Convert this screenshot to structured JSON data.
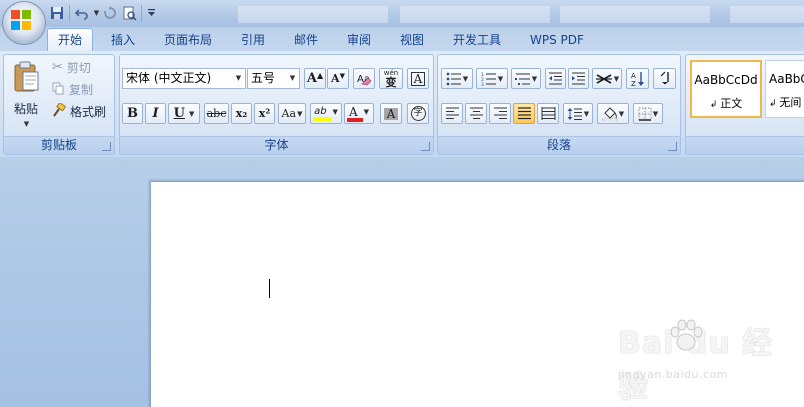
{
  "quick_access": {
    "icons": [
      "save-icon",
      "undo-icon",
      "redo-icon",
      "print-preview-icon",
      "customize-dropdown-icon"
    ]
  },
  "tabs": [
    {
      "label": "开始",
      "active": true
    },
    {
      "label": "插入"
    },
    {
      "label": "页面布局"
    },
    {
      "label": "引用"
    },
    {
      "label": "邮件"
    },
    {
      "label": "审阅"
    },
    {
      "label": "视图"
    },
    {
      "label": "开发工具"
    },
    {
      "label": "WPS PDF"
    }
  ],
  "clipboard": {
    "paste_label": "粘贴",
    "cut_label": "剪切",
    "copy_label": "复制",
    "format_painter_label": "格式刷",
    "group_label": "剪贴板"
  },
  "font": {
    "font_name": "宋体 (中文正文)",
    "font_size": "五号",
    "grow_label": "A",
    "shrink_label": "A",
    "clear_label": "A",
    "phonetic_label": "wén",
    "phonetic_char": "变",
    "border_label": "A",
    "bold": "B",
    "italic": "I",
    "underline": "U",
    "strike": "abc",
    "subscript": "x₂",
    "superscript": "x²",
    "case": "Aa",
    "highlight": "ab",
    "font_color": "A",
    "shading": "A",
    "enclose": "字",
    "group_label": "字体"
  },
  "paragraph": {
    "group_label": "段落"
  },
  "styles": [
    {
      "sample": "AaBbCcDd",
      "name": "正文",
      "selected": true
    },
    {
      "sample": "AaBbC",
      "name": "无间"
    }
  ],
  "colors": {
    "highlight": "#ffff00",
    "font_color": "#e02020",
    "accent": "#15428b"
  },
  "watermark": {
    "brand": "Bai du 经验",
    "url": "jingyan.baidu.com"
  }
}
